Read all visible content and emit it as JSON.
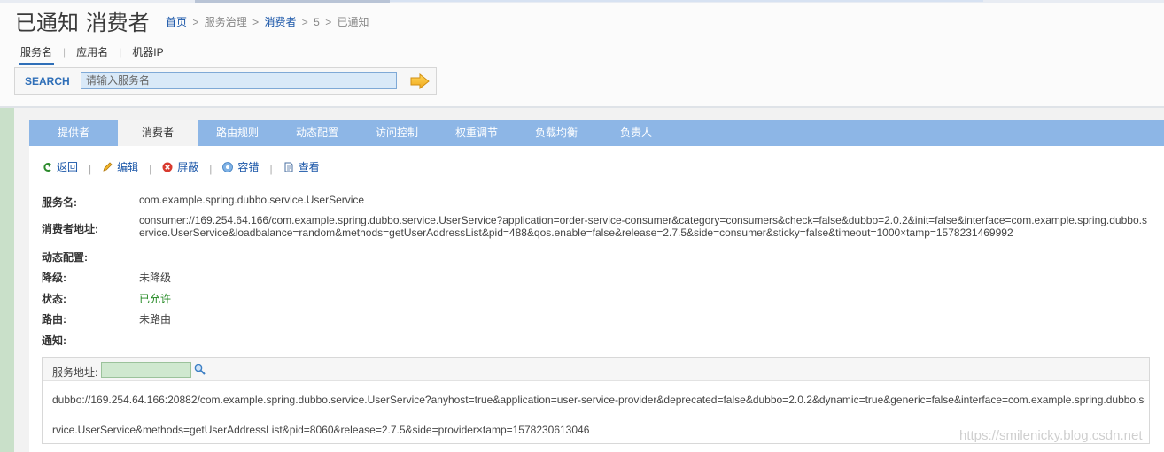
{
  "header": {
    "title": "已通知 消费者",
    "breadcrumb": {
      "home": "首页",
      "sep1": ">",
      "governance": "服务治理",
      "sep2": ">",
      "consumers": "消费者",
      "sep3": ">",
      "id": "5",
      "sep4": ">",
      "current": "已通知"
    }
  },
  "search": {
    "tabs": [
      "服务名",
      "应用名",
      "机器IP"
    ],
    "active_tab": "服务名",
    "label": "SEARCH",
    "placeholder": "请输入服务名",
    "go_icon": "arrow-right-icon"
  },
  "nav": {
    "items": [
      "提供者",
      "消费者",
      "路由规则",
      "动态配置",
      "访问控制",
      "权重调节",
      "负载均衡",
      "负责人"
    ],
    "active": "消费者"
  },
  "actions": {
    "back": "返回",
    "edit": "编辑",
    "shield": "屏蔽",
    "tolerance": "容错",
    "view": "查看"
  },
  "details": {
    "service_name_label": "服务名:",
    "service_name": "com.example.spring.dubbo.service.UserService",
    "consumer_url_label": "消费者地址:",
    "consumer_url": "consumer://169.254.64.166/com.example.spring.dubbo.service.UserService?application=order-service-consumer&category=consumers&check=false&dubbo=2.0.2&init=false&interface=com.example.spring.dubbo.service.UserService&loadbalance=random&methods=getUserAddressList&pid=488&qos.enable=false&release=2.7.5&side=consumer&sticky=false&timeout=1000×tamp=1578231469992",
    "dynamic_config_label": "动态配置:",
    "degrade_label": "降级:",
    "degrade_value": "未降级",
    "status_label": "状态:",
    "status_value": "已允许",
    "route_label": "路由:",
    "route_value": "未路由",
    "notify_label": "通知:"
  },
  "service_address": {
    "label": "服务地址:",
    "line1": "dubbo://169.254.64.166:20882/com.example.spring.dubbo.service.UserService?anyhost=true&application=user-service-provider&deprecated=false&dubbo=2.0.2&dynamic=true&generic=false&interface=com.example.spring.dubbo.se",
    "line2": "rvice.UserService&methods=getUserAddressList&pid=8060&release=2.7.5&side=provider×tamp=1578230613046"
  },
  "watermark": "https://smilenicky.blog.csdn.net",
  "colors": {
    "nav_bg": "#8db6e6",
    "link": "#1a56a8",
    "status_ok": "#228822",
    "left_band": "#c9e0c9"
  }
}
